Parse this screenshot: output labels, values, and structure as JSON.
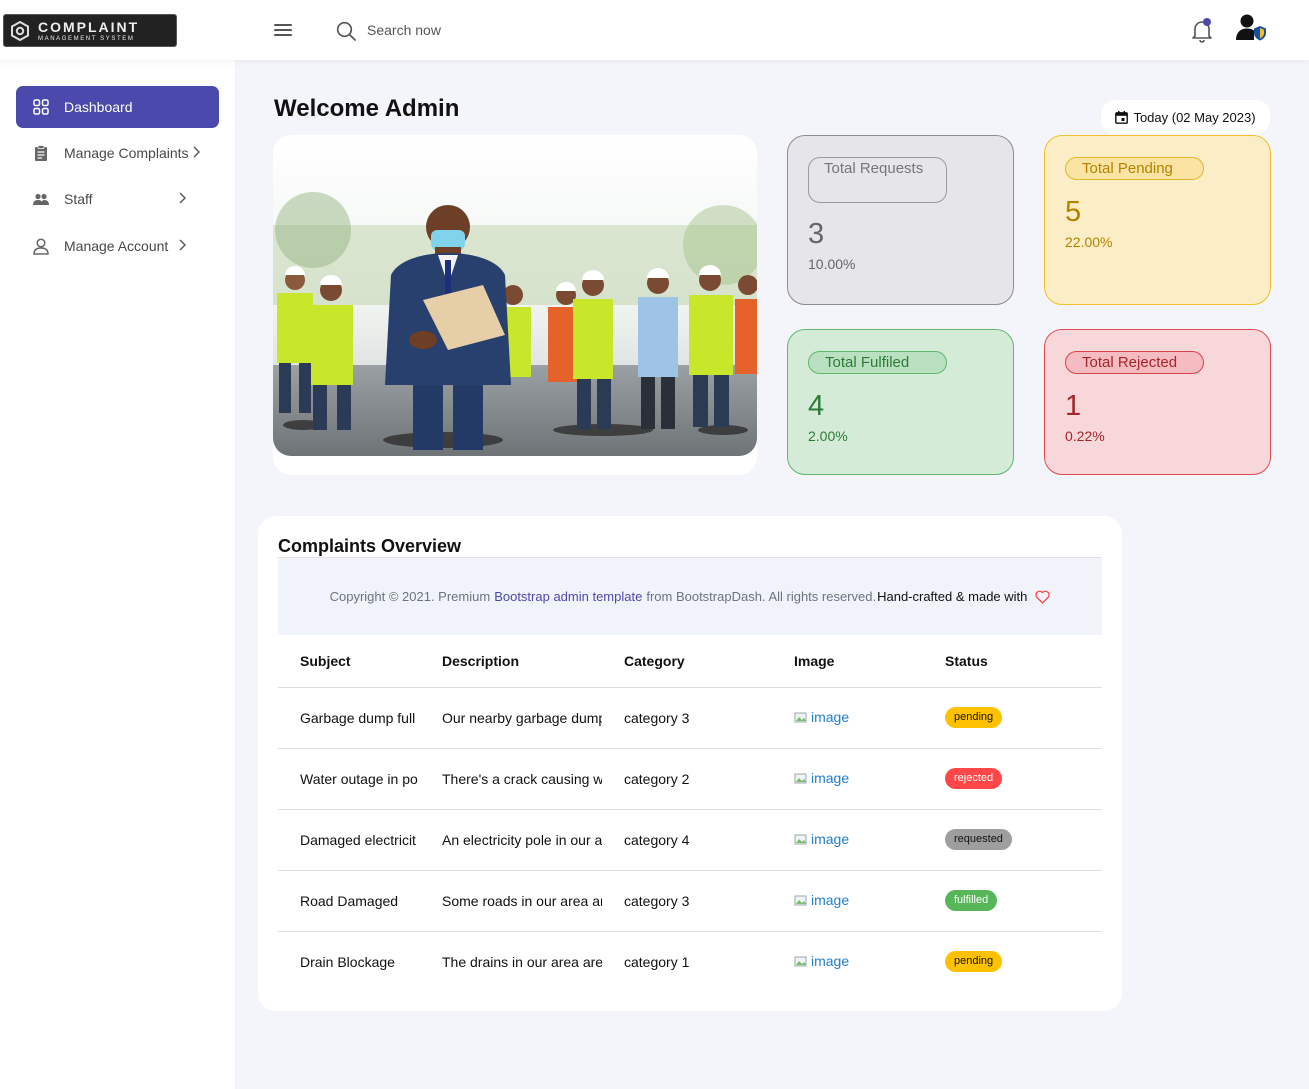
{
  "header": {
    "logo_title": "COMPLAINT",
    "logo_subtitle": "MANAGEMENT SYSTEM",
    "search_placeholder": "Search now"
  },
  "sidebar": {
    "items": [
      {
        "label": "Dashboard",
        "icon": "grid-icon",
        "active": true
      },
      {
        "label": "Manage Complaints",
        "icon": "clipboard-icon"
      },
      {
        "label": "Staff",
        "icon": "people-icon"
      },
      {
        "label": "Manage Account",
        "icon": "person-icon"
      }
    ]
  },
  "main": {
    "welcome": "Welcome Admin",
    "date": "Today (02 May 2023)"
  },
  "stats": {
    "total": {
      "label": "Total Requests",
      "value": "3",
      "percent": "10.00%"
    },
    "pending": {
      "label": "Total Pending",
      "value": "5",
      "percent": "22.00%"
    },
    "fulfilled": {
      "label": "Total Fulfiled",
      "value": "4",
      "percent": "2.00%"
    },
    "rejected": {
      "label": "Total Rejected",
      "value": "1",
      "percent": "0.22%"
    }
  },
  "overview": {
    "title": "Complaints Overview",
    "footer": {
      "copyright": "Copyright © 2021. Premium",
      "link": "Bootstrap admin template",
      "from": "from BootstrapDash. All rights reserved.",
      "crafted": "Hand-crafted & made with"
    },
    "columns": [
      "Subject",
      "Description",
      "Category",
      "Image",
      "Status"
    ],
    "rows": [
      {
        "subject": "Garbage dump full",
        "description": "Our nearby garbage dump",
        "category": "category 3",
        "image": "image",
        "status": "pending"
      },
      {
        "subject": "Water outage in po",
        "description": "There's a crack causing w",
        "category": "category 2",
        "image": "image",
        "status": "rejected"
      },
      {
        "subject": "Damaged electricit",
        "description": "An electricity pole in our a",
        "category": "category 4",
        "image": "image",
        "status": "requested"
      },
      {
        "subject": "Road Damaged",
        "description": "Some roads in our area ar",
        "category": "category 3",
        "image": "image",
        "status": "fulfilled"
      },
      {
        "subject": "Drain Blockage",
        "description": "The drains in our area are",
        "category": "category 1",
        "image": "image",
        "status": "pending"
      }
    ]
  },
  "colors": {
    "accent": "#4b49ac",
    "pending": "#ffc100",
    "rejected": "#ff4747",
    "requested": "#9e9e9e",
    "fulfilled": "#57b657"
  }
}
